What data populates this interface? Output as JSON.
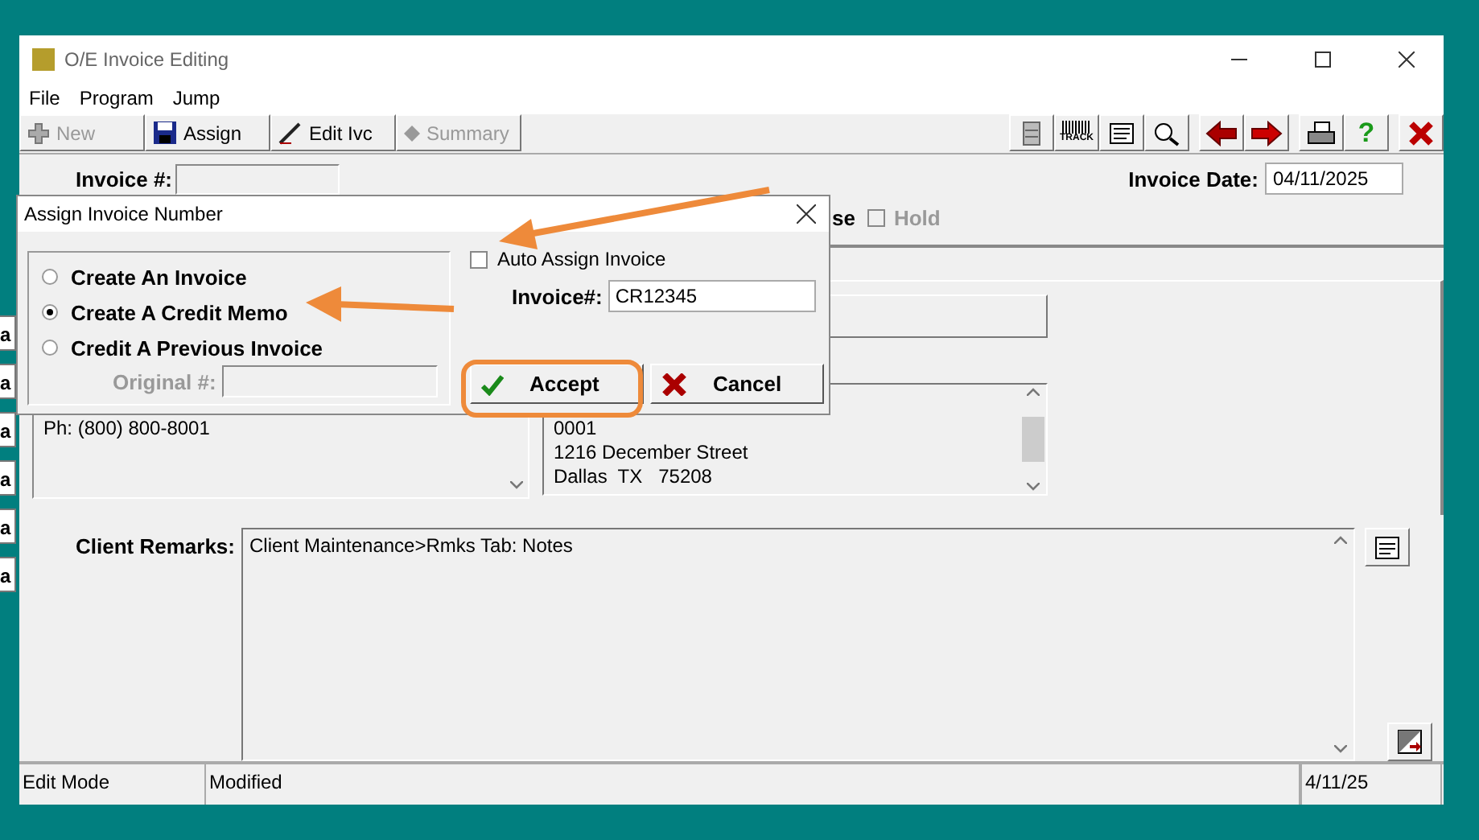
{
  "window": {
    "title": "O/E Invoice Editing"
  },
  "menu": [
    "File",
    "Program",
    "Jump"
  ],
  "toolbar": {
    "buttons": [
      {
        "label": "New",
        "kind": "plus",
        "disabled": true
      },
      {
        "label": "Assign",
        "kind": "save",
        "disabled": false
      },
      {
        "label": "Edit Ivc",
        "kind": "pen",
        "disabled": false
      },
      {
        "label": "Summary",
        "kind": "diamond",
        "disabled": true
      }
    ],
    "tools": [
      {
        "kind": "cabinet"
      },
      {
        "kind": "track",
        "label": "TRACK"
      },
      {
        "kind": "note"
      },
      {
        "kind": "search"
      },
      {
        "kind": "prev"
      },
      {
        "kind": "next"
      },
      {
        "kind": "print"
      },
      {
        "kind": "help",
        "label": "?"
      },
      {
        "kind": "close"
      }
    ]
  },
  "header": {
    "invoice_label": "Invoice #:",
    "invoice_date_label": "Invoice Date:",
    "invoice_date": "04/11/2025",
    "partial_label": "se",
    "hold": {
      "label": "Hold",
      "checked": false,
      "disabled": true
    }
  },
  "background_tabs": [
    "a",
    "a",
    "a",
    "a",
    "a",
    "a"
  ],
  "contact": {
    "phone": "Ph: (800) 800-8001"
  },
  "address": {
    "lines": [
      "0001",
      "1216 December Street",
      "Dallas  TX   75208"
    ]
  },
  "remarks": {
    "label": "Client Remarks:",
    "text": "Client Maintenance>Rmks Tab: Notes"
  },
  "status_bar": [
    "Edit Mode",
    "Modified",
    "4/11/25"
  ],
  "dialog": {
    "title": "Assign Invoice Number",
    "options": [
      {
        "label": "Create An Invoice",
        "selected": false
      },
      {
        "label": "Create A Credit Memo",
        "selected": true
      },
      {
        "label": "Credit A Previous Invoice",
        "selected": false
      }
    ],
    "original_label": "Original #:",
    "original_disabled": true,
    "auto_assign": {
      "label": "Auto Assign Invoice",
      "checked": false
    },
    "invoice_label": "Invoice#:",
    "invoice_value": "CR12345",
    "accept": "Accept",
    "cancel": "Cancel"
  }
}
